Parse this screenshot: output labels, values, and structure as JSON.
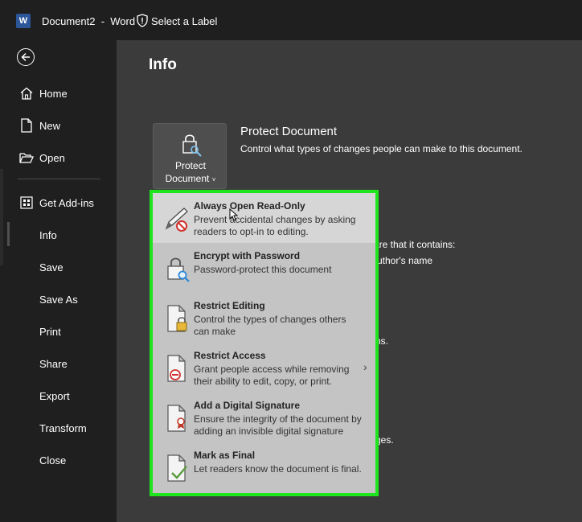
{
  "window": {
    "app_icon": "word-icon",
    "title": "Document2  -  Word",
    "label_icon": "shield-icon",
    "label_text": "Select a Label"
  },
  "nav": {
    "back_icon": "back-arrow-icon",
    "items": [
      {
        "label": "Home",
        "icon": "home-icon"
      },
      {
        "label": "New",
        "icon": "new-document-icon"
      },
      {
        "label": "Open",
        "icon": "folder-open-icon"
      },
      {
        "label": "Get Add-ins",
        "icon": "add-ins-grid-icon"
      },
      {
        "label": "Info"
      },
      {
        "label": "Save"
      },
      {
        "label": "Save As"
      },
      {
        "label": "Print"
      },
      {
        "label": "Share"
      },
      {
        "label": "Export"
      },
      {
        "label": "Transform"
      },
      {
        "label": "Close"
      }
    ],
    "active": "Info"
  },
  "page": {
    "title": "Info",
    "protect": {
      "button_line1": "Protect",
      "button_line2": "Document",
      "chevron": "˅",
      "heading": "Protect Document",
      "description": "Control what types of changes people can make to this document."
    },
    "obscured_text": {
      "line1": "are that it contains:",
      "line2": "uthor's name",
      "line3": "ns.",
      "line4": "ges."
    }
  },
  "protect_menu": {
    "items": [
      {
        "title": "Always Open Read-Only",
        "description": "Prevent accidental changes by asking readers to opt-in to editing.",
        "icon": "pencil-no-edit-icon"
      },
      {
        "title": "Encrypt with Password",
        "description": "Password-protect this document",
        "icon": "lock-key-icon"
      },
      {
        "title": "Restrict Editing",
        "description": "Control the types of changes others can make",
        "icon": "document-lock-icon"
      },
      {
        "title": "Restrict Access",
        "description": "Grant people access while removing their ability to edit, copy, or print.",
        "icon": "document-restricted-icon"
      },
      {
        "title": "Add a Digital Signature",
        "description": "Ensure the integrity of the document by adding an invisible digital signature",
        "icon": "document-ribbon-icon"
      },
      {
        "title": "Mark as Final",
        "description": "Let readers know the document is final.",
        "icon": "document-checkmark-icon"
      }
    ],
    "submenu_arrow": "›",
    "highlight_color": "#1fe51f"
  }
}
